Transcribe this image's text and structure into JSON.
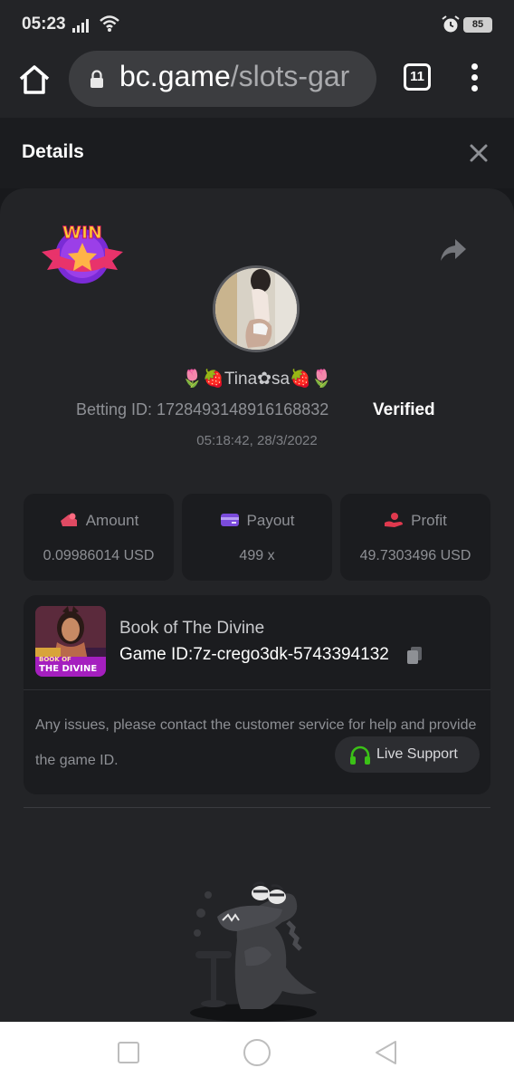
{
  "status_bar": {
    "time": "05:23",
    "battery": "85"
  },
  "browser": {
    "url_domain": "bc.game",
    "url_path": "/slots-gar",
    "tab_count": "11"
  },
  "details": {
    "title": "Details"
  },
  "bet": {
    "username": "🌷🍓Tina✿sa🍓🌷",
    "betting_id_label": "Betting ID: 1728493148916168832",
    "verified_label": "Verified",
    "timestamp": "05:18:42, 28/3/2022",
    "badge_text": "WIN"
  },
  "stats": [
    {
      "label": "Amount",
      "value": "0.09986014 USD",
      "icon": "amount-icon",
      "color": "#e04a63"
    },
    {
      "label": "Payout",
      "value": "499 x",
      "icon": "payout-card-icon",
      "color": "#7a4bdb"
    },
    {
      "label": "Profit",
      "value": "49.7303496 USD",
      "icon": "profit-hand-icon",
      "color": "#e0394e"
    }
  ],
  "game": {
    "name": "Book of The Divine",
    "id_label": "Game ID:7z-crego3dk-5743394132",
    "thumb_line1": "BOOK OF",
    "thumb_line2": "THE DIVINE",
    "issue_text": "Any issues, please contact the customer service for help and provide the game ID.",
    "live_support_label": "Live Support"
  },
  "colors": {
    "accent_green": "#3bc117",
    "win_pink": "#e8336b",
    "win_purple": "#7a2bd6"
  }
}
